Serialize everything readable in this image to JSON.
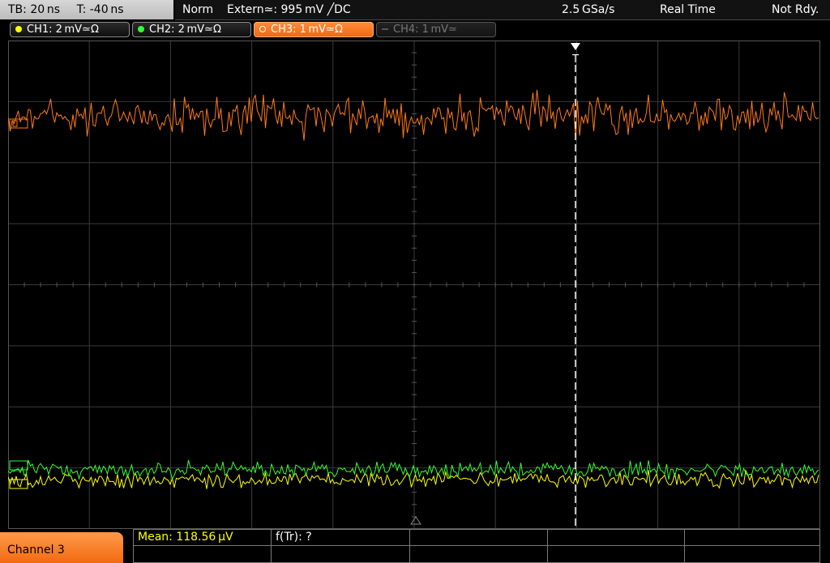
{
  "status": {
    "timebase": "TB: 20 ns",
    "trigger_time": "T: -40 ns",
    "mode": "Norm",
    "trigger_source": "Extern≃: 995 mV ╱DC",
    "sample_rate": "2.5 GSa/s",
    "acquisition": "Real Time",
    "state": "Not Rdy."
  },
  "channels": [
    {
      "label": "CH1: 2 mV≃Ω",
      "color": "#ffff00",
      "state": "on"
    },
    {
      "label": "CH2: 2 mV≃Ω",
      "color": "#33ff33",
      "state": "on"
    },
    {
      "label": "CH3: 1 mV≃Ω",
      "color": "#ff7a1a",
      "state": "selected"
    },
    {
      "label": "CH4: 1 mV≃",
      "color": "#666666",
      "state": "off"
    }
  ],
  "trigger_marker": "T",
  "bottom": {
    "selected_channel": "Channel 3",
    "measurements": [
      {
        "label": "Mean: 118.56 µV",
        "color": "#ffff00"
      },
      {
        "label": "f(Tr): ?",
        "color": "#ffffff"
      }
    ]
  },
  "colors": {
    "ch1": "#ffff00",
    "ch2": "#33ff33",
    "ch3": "#ff7a1a",
    "grid": "#3a3a3a",
    "trigger_line": "#ffffff"
  }
}
